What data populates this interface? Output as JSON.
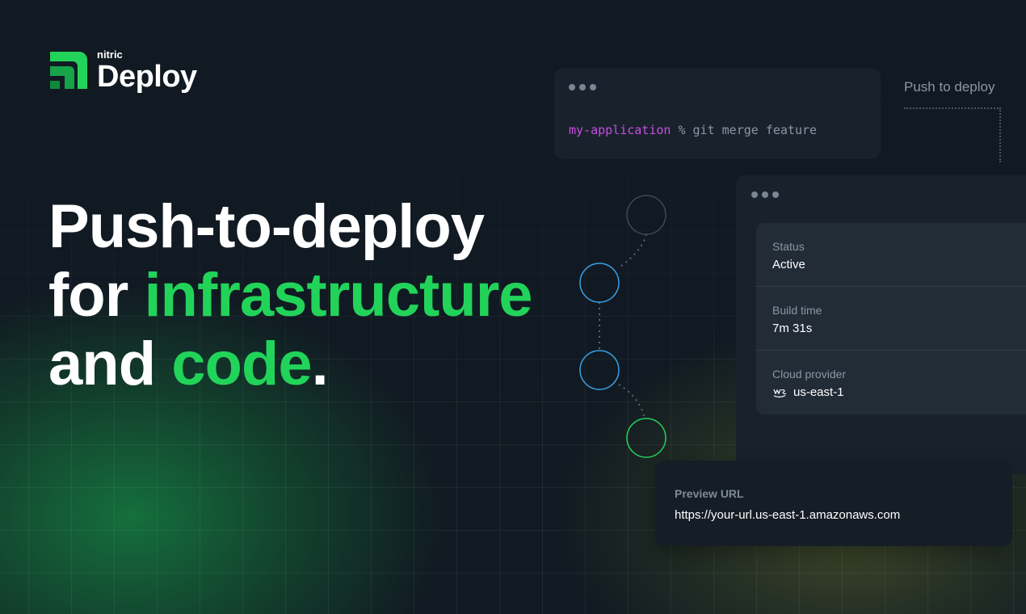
{
  "brand": {
    "company": "nitric",
    "product": "Deploy",
    "color_green": "#22d35a",
    "color_dark_green": "#0f8a3a"
  },
  "headline": {
    "line1": "Push-to-deploy",
    "line2_prefix": "for ",
    "line2_accent": "infrastructure",
    "line3_prefix": "and ",
    "line3_accent": "code",
    "line3_suffix": "."
  },
  "terminal": {
    "directory": "my-application",
    "command": " % git merge feature"
  },
  "push_label": "Push to deploy",
  "status_panel": {
    "rows": [
      {
        "label": "Status",
        "value": "Active"
      },
      {
        "label": "Build time",
        "value": "7m 31s"
      },
      {
        "label": "Cloud provider",
        "value": "us-east-1",
        "icon": "aws-icon"
      }
    ]
  },
  "preview": {
    "label": "Preview URL",
    "url": "https://your-url.us-east-1.amazonaws.com"
  },
  "pipeline": {
    "steps": [
      {
        "name": "pipeline-step-pending",
        "color": "#3e4752"
      },
      {
        "name": "pipeline-step-build",
        "color": "#3aa0e8"
      },
      {
        "name": "pipeline-step-deploy",
        "color": "#3aa0e8"
      },
      {
        "name": "pipeline-step-live",
        "color": "#22d35a"
      }
    ]
  }
}
